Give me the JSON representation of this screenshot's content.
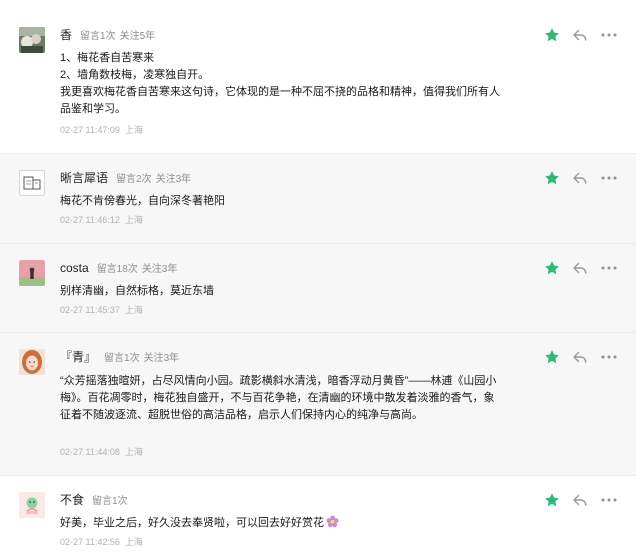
{
  "icons": {
    "star": "star-filled-icon",
    "reply": "reply-arrow-icon",
    "more": "more-dots-icon"
  },
  "colors": {
    "star_green": "#2fb879",
    "action_gray": "#9a9a9f",
    "meta_gray": "#8e8e93"
  },
  "comments": [
    {
      "nickname": "香",
      "count": "留言1次",
      "follow": "关注5年",
      "content": [
        "1、梅花香自苦寒来",
        "2、墙角数枝梅，凌寒独自开。",
        "我更喜欢梅花香自苦寒来这句诗，它体现的是一种不屈不挠的品格和精神，值得我们所有人品鉴和学习。"
      ],
      "time": "02-27 11:47:09",
      "location": "上海"
    },
    {
      "nickname": "晰言犀语",
      "count": "留言2次",
      "follow": "关注3年",
      "content": [
        "梅花不肯傍春光，自向深冬著艳阳"
      ],
      "time": "02-27 11:46:12",
      "location": "上海"
    },
    {
      "nickname": "costa",
      "count": "留言18次",
      "follow": "关注3年",
      "content": [
        "别样清幽，自然标格，莫近东墙"
      ],
      "time": "02-27 11:45:37",
      "location": "上海"
    },
    {
      "nickname": "『青』",
      "count": "留言1次",
      "follow": "关注3年",
      "content": [
        "“众芳摇落独暄妍，占尽风情向小园。疏影横斜水清浅，暗香浮动月黄昏”——林逋《山园小梅》。百花凋零时，梅花独自盛开，不与百花争艳，在清幽的环境中散发着淡雅的香气，象征着不随波逐流、超脱世俗的高洁品格，启示人们保持内心的纯净与高尚。"
      ],
      "time": "02-27 11:44:08",
      "location": "上海"
    },
    {
      "nickname": "不食",
      "count": "留言1次",
      "follow": "",
      "content": [
        "好美，毕业之后，好久没去奉贤啦，可以回去好好赏花"
      ],
      "time": "02-27 11:42:56",
      "location": "上海"
    }
  ]
}
